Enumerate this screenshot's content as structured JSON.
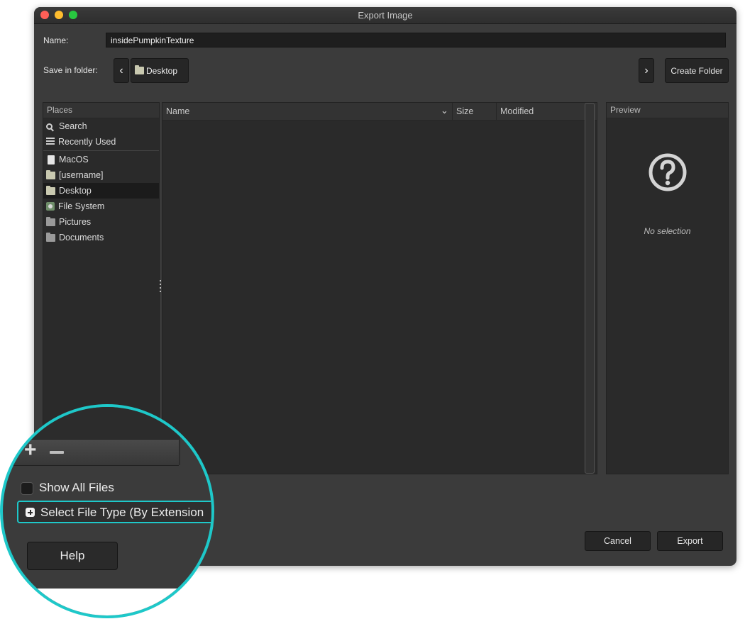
{
  "window": {
    "title": "Export Image"
  },
  "name_field": {
    "label": "Name:",
    "value": "insidePumpkinTexture"
  },
  "save_in": {
    "label": "Save in folder:",
    "back_icon": "chevron-left-icon",
    "path_button": "Desktop",
    "forward_icon": "chevron-right-icon",
    "create_folder": "Create Folder"
  },
  "places": {
    "header": "Places",
    "items": [
      {
        "label": "Search",
        "icon": "search-icon"
      },
      {
        "label": "Recently Used",
        "icon": "recent-icon"
      },
      {
        "label": "MacOS",
        "icon": "document-icon"
      },
      {
        "label": "[username]",
        "icon": "folder-icon"
      },
      {
        "label": "Desktop",
        "icon": "folder-icon",
        "selected": true
      },
      {
        "label": "File System",
        "icon": "filesystem-icon"
      },
      {
        "label": "Pictures",
        "icon": "folder-icon"
      },
      {
        "label": "Documents",
        "icon": "folder-icon"
      }
    ]
  },
  "file_list": {
    "columns": {
      "name": "Name",
      "size": "Size",
      "modified": "Modified"
    }
  },
  "preview": {
    "header": "Preview",
    "icon": "question-mark-icon",
    "empty_text": "No selection"
  },
  "buttons": {
    "cancel": "Cancel",
    "export": "Export",
    "help": "Help"
  },
  "options": {
    "show_all_files": "Show All Files",
    "select_file_type": "Select File Type (By Extension"
  },
  "colors": {
    "lens_border": "#1ec8c9",
    "window_bg": "#3b3b3b"
  }
}
